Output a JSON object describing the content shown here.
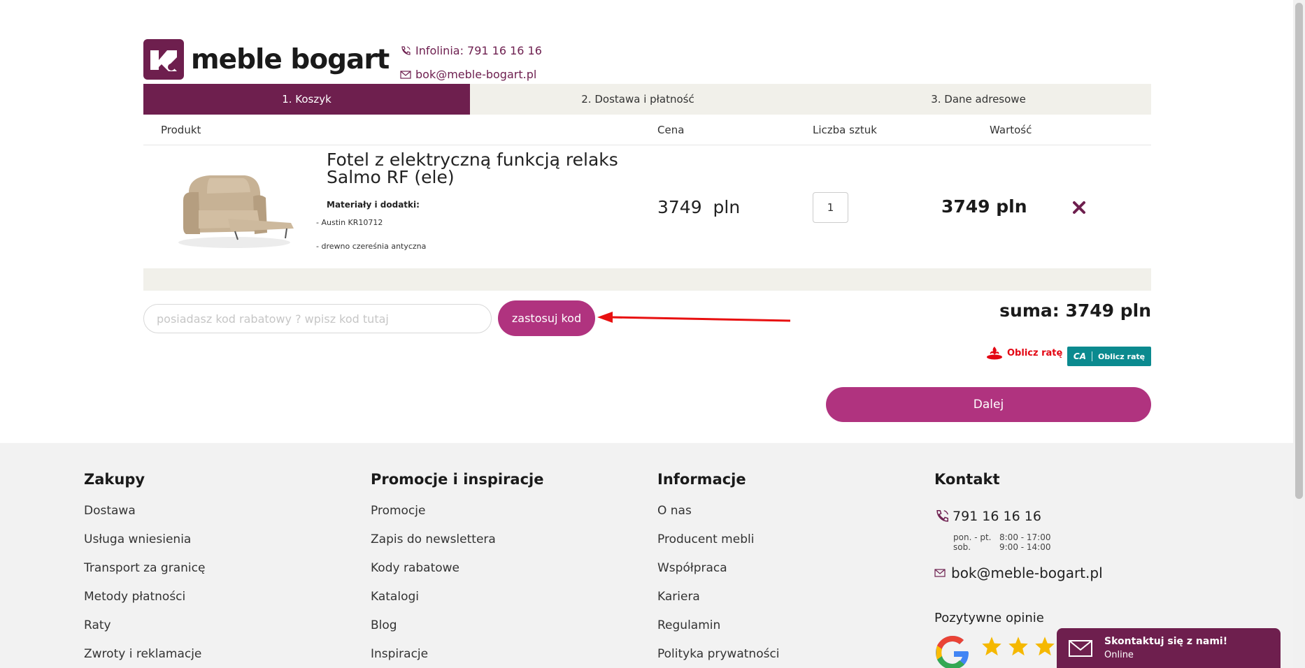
{
  "header": {
    "brand": "meble bogart",
    "phone_label": "Infolinia: 791 16 16 16",
    "email": "bok@meble-bogart.pl"
  },
  "steps": [
    {
      "label": "1. Koszyk"
    },
    {
      "label": "2. Dostawa i płatność"
    },
    {
      "label": "3. Dane adresowe"
    }
  ],
  "cart": {
    "columns": {
      "product": "Produkt",
      "price": "Cena",
      "quantity": "Liczba sztuk",
      "value": "Wartość"
    },
    "item": {
      "title": "Fotel z elektryczną funkcją relaks Salmo RF (ele)",
      "materials_heading": "Materiały i dodatki:",
      "materials": [
        "- Austin KR10712",
        "- drewno czereśnia antyczna"
      ],
      "price": "3749  pln",
      "quantity": "1",
      "value": "3749 pln"
    },
    "discount": {
      "placeholder": "posiadasz kod rabatowy ? wpisz kod tutaj",
      "apply_label": "zastosuj kod"
    },
    "total": "suma: 3749 pln",
    "santander_label": "Oblicz ratę",
    "ca_label": "Oblicz ratę",
    "ca_logo": "CA",
    "next_label": "Dalej"
  },
  "footer": {
    "shopping": {
      "title": "Zakupy",
      "links": [
        "Dostawa",
        "Usługa wniesienia",
        "Transport za granicę",
        "Metody płatności",
        "Raty",
        "Zwroty i reklamacje"
      ]
    },
    "promos": {
      "title": "Promocje i inspiracje",
      "links": [
        "Promocje",
        "Zapis do newslettera",
        "Kody rabatowe",
        "Katalogi",
        "Blog",
        "Inspiracje"
      ]
    },
    "info": {
      "title": "Informacje",
      "links": [
        "O nas",
        "Producent mebli",
        "Współpraca",
        "Kariera",
        "Regulamin",
        "Polityka prywatności"
      ]
    },
    "contact": {
      "title": "Kontakt",
      "phone": "791 16 16 16",
      "hours": [
        {
          "days": "pon. - pt.",
          "time": "8:00 - 17:00"
        },
        {
          "days": "sob.",
          "time": "9:00 - 14:00"
        }
      ],
      "email": "bok@meble-bogart.pl",
      "reviews_label": "Pozytywne opinie"
    }
  },
  "chat": {
    "title": "Skontaktuj się z nami!",
    "status": "Online"
  },
  "colors": {
    "brand": "#6e1f4e",
    "accent": "#b0337f",
    "step_bg": "#f1f0ea",
    "footer_bg": "#f2f2f2",
    "star": "#f5b800",
    "arrow": "#e81010"
  }
}
